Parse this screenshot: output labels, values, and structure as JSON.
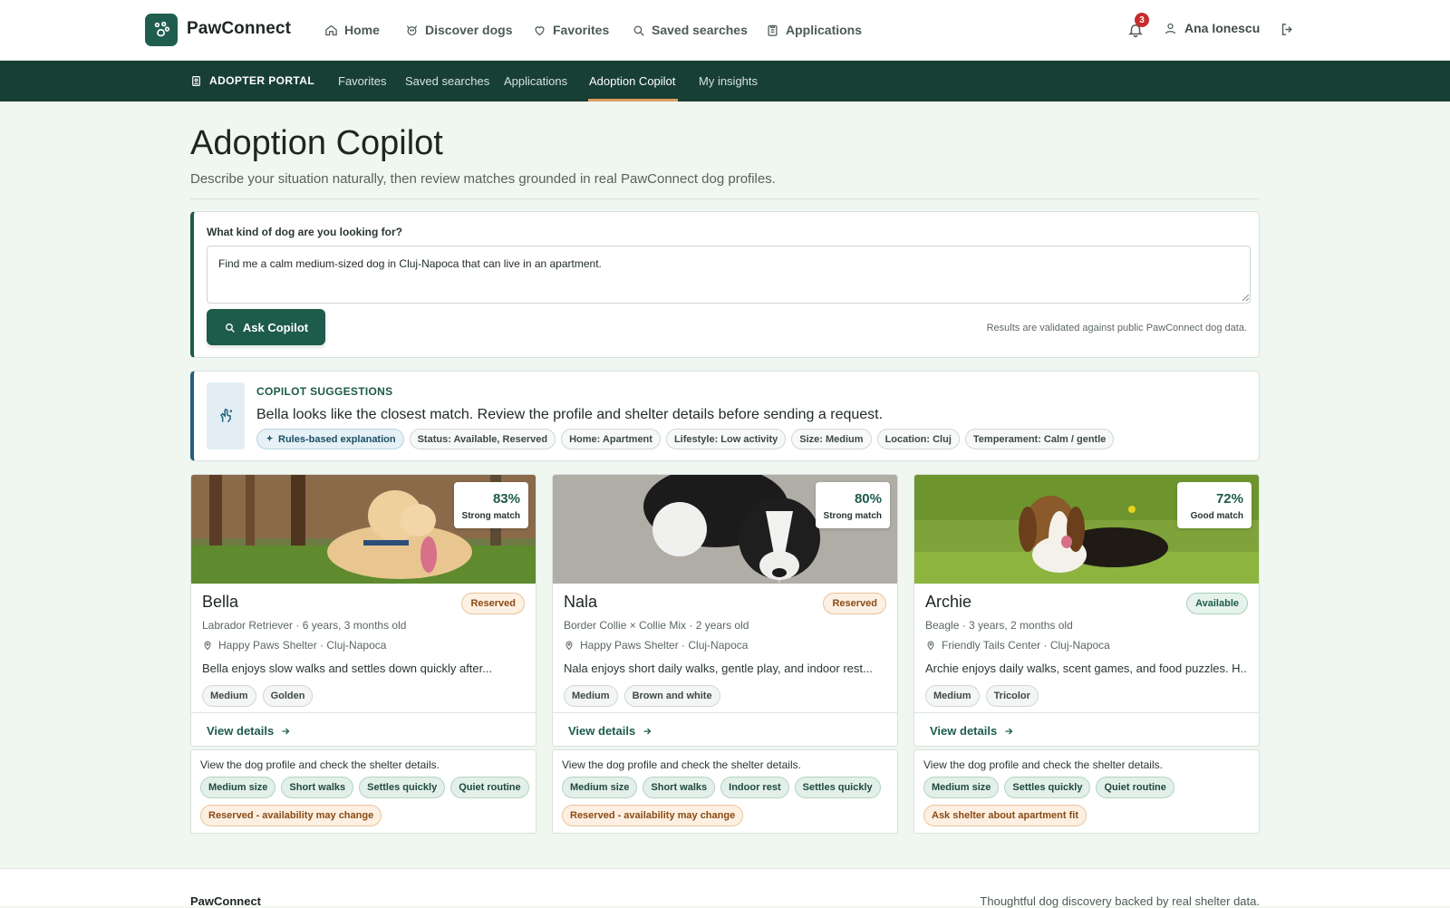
{
  "topnav": {
    "brand": "PawConnect",
    "items": [
      {
        "label": "Home",
        "icon": "home-icon"
      },
      {
        "label": "Discover dogs",
        "icon": "dog-icon"
      },
      {
        "label": "Favorites",
        "icon": "heart-icon"
      },
      {
        "label": "Saved searches",
        "icon": "search-icon"
      },
      {
        "label": "Applications",
        "icon": "clipboard-icon"
      }
    ],
    "notification_count": "3",
    "user_name": "Ana Ionescu"
  },
  "subnav": {
    "portal_label": "ADOPTER PORTAL",
    "items": [
      "Favorites",
      "Saved searches",
      "Applications",
      "Adoption Copilot",
      "My insights"
    ],
    "active": "Adoption Copilot"
  },
  "header": {
    "title": "Adoption Copilot",
    "subtitle": "Describe your situation naturally, then review matches grounded in real PawConnect dog profiles."
  },
  "query": {
    "label": "What kind of dog are you looking for?",
    "value": "Find me a calm medium-sized dog in Cluj-Napoca that can live in an apartment.",
    "button_label": "Ask Copilot",
    "note": "Results are validated against public PawConnect dog data."
  },
  "suggestions": {
    "title": "COPILOT SUGGESTIONS",
    "text": "Bella looks like the closest match. Review the profile and shelter details before sending a request.",
    "chips": [
      "Rules-based explanation",
      "Status: Available, Reserved",
      "Home: Apartment",
      "Lifestyle: Low activity",
      "Size: Medium",
      "Location: Cluj",
      "Temperament: Calm / gentle"
    ]
  },
  "dogs": [
    {
      "match_pct": "83%",
      "match_label": "Strong match",
      "name": "Bella",
      "status": "Reserved",
      "breed_age": "Labrador Retriever · 6 years, 3 months old",
      "location": "Happy Paws Shelter · Cluj-Napoca",
      "description": "Bella enjoys slow walks and settles down quickly after...",
      "tags": [
        "Medium",
        "Golden"
      ],
      "view_label": "View details",
      "reason": "View the dog profile and check the shelter details.",
      "reason_tags": [
        "Medium size",
        "Short walks",
        "Settles quickly",
        "Quiet routine"
      ],
      "reason_warning": "Reserved - availability may change"
    },
    {
      "match_pct": "80%",
      "match_label": "Strong match",
      "name": "Nala",
      "status": "Reserved",
      "breed_age": "Border Collie × Collie Mix · 2 years old",
      "location": "Happy Paws Shelter · Cluj-Napoca",
      "description": "Nala enjoys short daily walks, gentle play, and indoor rest...",
      "tags": [
        "Medium",
        "Brown and white"
      ],
      "view_label": "View details",
      "reason": "View the dog profile and check the shelter details.",
      "reason_tags": [
        "Medium size",
        "Short walks",
        "Indoor rest",
        "Settles quickly"
      ],
      "reason_warning": "Reserved - availability may change"
    },
    {
      "match_pct": "72%",
      "match_label": "Good match",
      "name": "Archie",
      "status": "Available",
      "breed_age": "Beagle · 3 years, 2 months old",
      "location": "Friendly Tails Center · Cluj-Napoca",
      "description": "Archie enjoys daily walks, scent games, and food puzzles. H...",
      "tags": [
        "Medium",
        "Tricolor"
      ],
      "view_label": "View details",
      "reason": "View the dog profile and check the shelter details.",
      "reason_tags": [
        "Medium size",
        "Settles quickly",
        "Quiet routine"
      ],
      "reason_warning": "Ask shelter about apartment fit"
    }
  ],
  "footer": {
    "brand": "PawConnect",
    "tagline": "Thoughtful dog discovery backed by real shelter data."
  },
  "colors": {
    "primary": "#1d5b4b",
    "subnav": "#183f35",
    "accent": "#d99e62",
    "reserved": "#8a4a14"
  }
}
